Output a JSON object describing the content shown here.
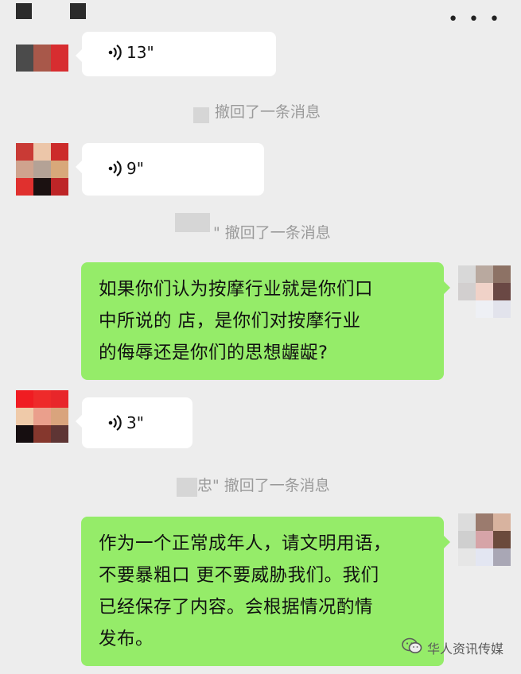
{
  "header": {
    "menu_icon": "more-dots-icon",
    "menu_glyph": "• • •"
  },
  "messages": [
    {
      "id": "voice-1",
      "type": "voice",
      "duration": "13\""
    },
    {
      "id": "recall-1",
      "type": "recall",
      "text": "撤回了一条消息"
    },
    {
      "id": "voice-2",
      "type": "voice",
      "duration": "9\""
    },
    {
      "id": "recall-2",
      "type": "recall",
      "text": "\" 撤回了一条消息"
    },
    {
      "id": "text-1",
      "type": "text",
      "side": "right",
      "text": "如果你们认为按摩行业就是你们口\n中所说的 店，是你们对按摩行业\n的侮辱还是你们的思想龌龊?"
    },
    {
      "id": "voice-3",
      "type": "voice",
      "duration": "3\""
    },
    {
      "id": "recall-3",
      "type": "recall",
      "text": "忠\" 撤回了一条消息"
    },
    {
      "id": "text-2",
      "type": "text",
      "side": "right",
      "text": "作为一个正常成年人，请文明用语，\n不要暴粗口 更不要威胁我们。我们\n已经保存了内容。会根据情况酌情\n发布。"
    }
  ],
  "watermark": {
    "text": "华人资讯传媒",
    "icon": "wechat-logo-icon"
  },
  "colors": {
    "background": "#ededed",
    "incoming_bubble": "#ffffff",
    "outgoing_bubble": "#95ec69"
  }
}
